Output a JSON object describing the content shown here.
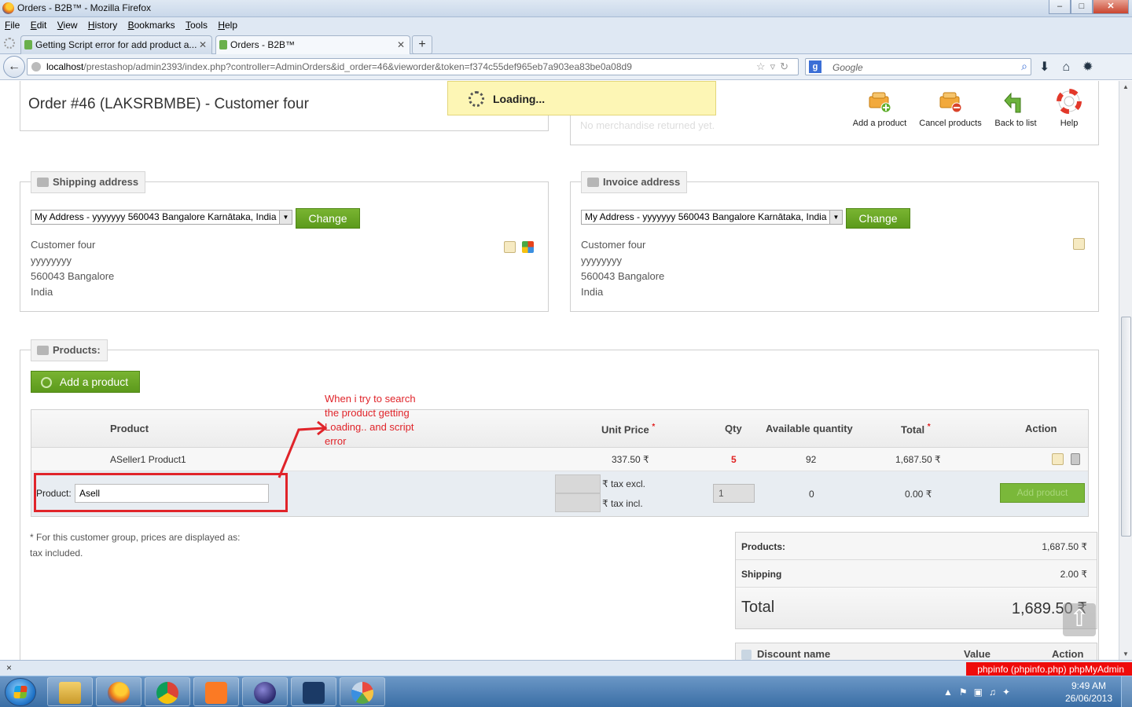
{
  "window": {
    "title": "Orders - B2B™ - Mozilla Firefox",
    "controls": [
      "–",
      "□",
      "✕"
    ]
  },
  "menu": [
    "File",
    "Edit",
    "View",
    "History",
    "Bookmarks",
    "Tools",
    "Help"
  ],
  "tabs": [
    {
      "label": "Getting Script error for add product a..."
    },
    {
      "label": "Orders - B2B™"
    }
  ],
  "address_bar": {
    "host": "localhost",
    "path": "/prestashop/admin2393/index.php?controller=AdminOrders&id_order=46&vieworder&token=f374c55def965eb7a903ea83be0a08d9"
  },
  "search": {
    "placeholder": "Google",
    "engine_letter": "g"
  },
  "loading_message": "Loading...",
  "ghost_text": "No merchandise returned yet.",
  "order": {
    "title": "Order #46 (LAKSRBMBE) - Customer four"
  },
  "toolbar": {
    "add_product": "Add a product",
    "cancel_products": "Cancel products",
    "back_to_list": "Back to list",
    "help": "Help"
  },
  "shipping": {
    "legend": "Shipping address",
    "selected": "My Address - yyyyyyy 560043 Bangalore Karnātaka, India",
    "change": "Change",
    "name": "Customer four",
    "line1": "yyyyyyyy",
    "line2": "560043 Bangalore",
    "country": "India"
  },
  "invoice": {
    "legend": "Invoice address",
    "selected": "My Address - yyyyyyy 560043 Bangalore Karnātaka, India",
    "change": "Change",
    "name": "Customer four",
    "line1": "yyyyyyyy",
    "line2": "560043 Bangalore",
    "country": "India"
  },
  "products": {
    "legend": "Products:",
    "add_button": "Add a product",
    "headers": {
      "product": "Product",
      "unit_price": "Unit Price",
      "qty": "Qty",
      "available": "Available quantity",
      "total": "Total",
      "action": "Action",
      "required_mark": "*"
    },
    "rows": [
      {
        "name": "ASeller1 Product1",
        "unit_price": "337.50 ₹",
        "qty": "5",
        "available": "92",
        "total": "1,687.50 ₹"
      }
    ],
    "new_row": {
      "label": "Product:",
      "value": "Asell",
      "tax_excl": "₹ tax excl.",
      "tax_incl": "₹ tax incl.",
      "qty": "1",
      "available": "0",
      "total": "0.00 ₹",
      "button": "Add product"
    }
  },
  "note": "* For this customer group, prices are displayed as: tax included.",
  "totals": {
    "products_label": "Products:",
    "products_value": "1,687.50 ₹",
    "shipping_label": "Shipping",
    "shipping_value": "2.00 ₹",
    "total_label": "Total",
    "total_value": "1,689.50 ₹"
  },
  "discounts": {
    "name": "Discount name",
    "value": "Value",
    "action": "Action"
  },
  "annotation": {
    "text": "When i try to search the product getting Loading.. and script error",
    "color": "#e0242a"
  },
  "statusbar": {
    "close": "×",
    "links": "phpinfo (phpinfo.php)  phpMyAdmin"
  },
  "taskbar": {
    "time": "9:49 AM",
    "date": "26/06/2013"
  },
  "colors": {
    "green_button": "#6aa626",
    "alert_red": "#e02020",
    "loading_bg": "#fdf6b5"
  }
}
